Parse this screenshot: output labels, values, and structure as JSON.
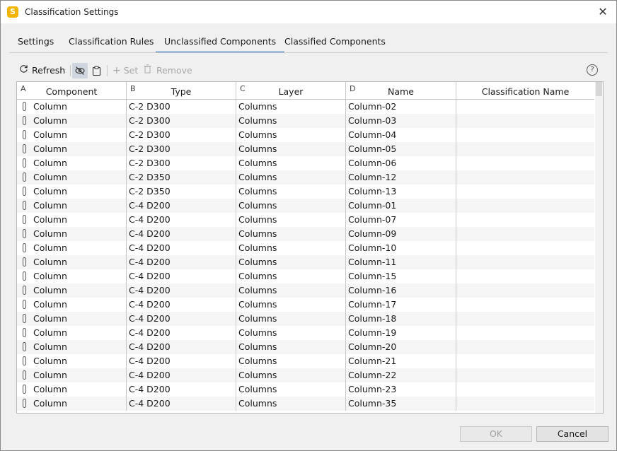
{
  "window": {
    "title": "Classification Settings",
    "app_icon_letter": "S",
    "close_glyph": "✕"
  },
  "tabs": [
    {
      "label": "Settings"
    },
    {
      "label": "Classification Rules"
    },
    {
      "label": "Unclassified Components"
    },
    {
      "label": "Classified Components"
    }
  ],
  "active_tab": "Unclassified Components",
  "toolbar": {
    "refresh_label": "Refresh",
    "set_label": "Set",
    "remove_label": "Remove",
    "help_glyph": "?"
  },
  "table": {
    "columns": [
      {
        "letter": "A",
        "name": "Component"
      },
      {
        "letter": "B",
        "name": "Type"
      },
      {
        "letter": "C",
        "name": "Layer"
      },
      {
        "letter": "D",
        "name": "Name"
      },
      {
        "letter": "",
        "name": "Classification Name"
      }
    ],
    "rows": [
      [
        "Column",
        "C-2 D300",
        "Columns",
        "Column-02",
        ""
      ],
      [
        "Column",
        "C-2 D300",
        "Columns",
        "Column-03",
        ""
      ],
      [
        "Column",
        "C-2 D300",
        "Columns",
        "Column-04",
        ""
      ],
      [
        "Column",
        "C-2 D300",
        "Columns",
        "Column-05",
        ""
      ],
      [
        "Column",
        "C-2 D300",
        "Columns",
        "Column-06",
        ""
      ],
      [
        "Column",
        "C-2 D350",
        "Columns",
        "Column-12",
        ""
      ],
      [
        "Column",
        "C-2 D350",
        "Columns",
        "Column-13",
        ""
      ],
      [
        "Column",
        "C-4 D200",
        "Columns",
        "Column-01",
        ""
      ],
      [
        "Column",
        "C-4 D200",
        "Columns",
        "Column-07",
        ""
      ],
      [
        "Column",
        "C-4 D200",
        "Columns",
        "Column-09",
        ""
      ],
      [
        "Column",
        "C-4 D200",
        "Columns",
        "Column-10",
        ""
      ],
      [
        "Column",
        "C-4 D200",
        "Columns",
        "Column-11",
        ""
      ],
      [
        "Column",
        "C-4 D200",
        "Columns",
        "Column-15",
        ""
      ],
      [
        "Column",
        "C-4 D200",
        "Columns",
        "Column-16",
        ""
      ],
      [
        "Column",
        "C-4 D200",
        "Columns",
        "Column-17",
        ""
      ],
      [
        "Column",
        "C-4 D200",
        "Columns",
        "Column-18",
        ""
      ],
      [
        "Column",
        "C-4 D200",
        "Columns",
        "Column-19",
        ""
      ],
      [
        "Column",
        "C-4 D200",
        "Columns",
        "Column-20",
        ""
      ],
      [
        "Column",
        "C-4 D200",
        "Columns",
        "Column-21",
        ""
      ],
      [
        "Column",
        "C-4 D200",
        "Columns",
        "Column-22",
        ""
      ],
      [
        "Column",
        "C-4 D200",
        "Columns",
        "Column-23",
        ""
      ],
      [
        "Column",
        "C-4 D200",
        "Columns",
        "Column-35",
        ""
      ]
    ]
  },
  "buttons": {
    "ok_label": "OK",
    "cancel_label": "Cancel"
  },
  "colors": {
    "accent": "#1565c0",
    "app_icon": "#f3b400"
  }
}
